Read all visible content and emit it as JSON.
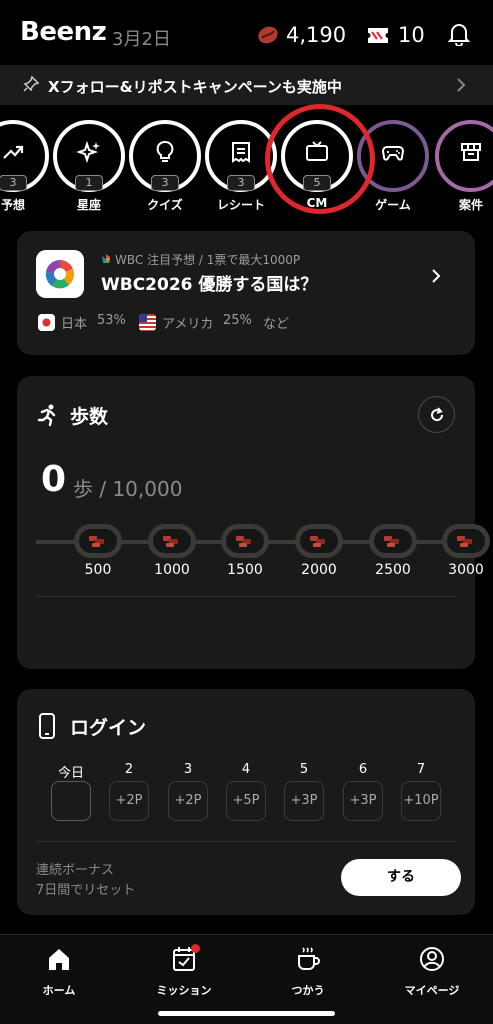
{
  "header": {
    "brand": "Beenz",
    "date": "3月2日",
    "bean_count": "4,190",
    "ticket_count": "10",
    "icons": [
      "bean-icon",
      "ticket-icon",
      "bell-icon"
    ]
  },
  "banner": {
    "text": "Xフォロー&リポストキャンペーンも実施中",
    "icon": "pin-icon"
  },
  "categories": [
    {
      "label": "予想",
      "count": "3",
      "icon": "trend-up-icon"
    },
    {
      "label": "星座",
      "count": "1",
      "icon": "sparkle-icon"
    },
    {
      "label": "クイズ",
      "count": "3",
      "icon": "lightbulb-icon"
    },
    {
      "label": "レシート",
      "count": "3",
      "icon": "receipt-icon"
    },
    {
      "label": "CM",
      "count": "5",
      "icon": "tv-icon"
    },
    {
      "label": "ゲーム",
      "count": "",
      "icon": "gamepad-icon"
    },
    {
      "label": "案件",
      "count": "",
      "icon": "shop-icon"
    }
  ],
  "prediction": {
    "tag": "WBC 注目予想 / 1票で最大1000P",
    "title": "WBC2026 優勝する国は？",
    "options": [
      {
        "name": "日本",
        "percent": "53%"
      },
      {
        "name": "アメリカ",
        "percent": "25%"
      }
    ],
    "more": "など"
  },
  "steps": {
    "title": "歩数",
    "value": "0",
    "unit_goal": "歩 / 10,000",
    "progress": 0,
    "milestones": [
      "500",
      "1000",
      "1500",
      "2000",
      "2500",
      "3000"
    ]
  },
  "login": {
    "title": "ログイン",
    "days": [
      {
        "label": "今日",
        "reward": ""
      },
      {
        "label": "2",
        "reward": "+2P"
      },
      {
        "label": "3",
        "reward": "+2P"
      },
      {
        "label": "4",
        "reward": "+5P"
      },
      {
        "label": "5",
        "reward": "+3P"
      },
      {
        "label": "6",
        "reward": "+3P"
      },
      {
        "label": "7",
        "reward": "+10P"
      }
    ],
    "bonus_title": "連続ボーナス",
    "bonus_sub": "7日間でリセット",
    "button": "する"
  },
  "tabs": [
    {
      "label": "ホーム",
      "icon": "home-icon"
    },
    {
      "label": "ミッション",
      "icon": "calendar-check-icon"
    },
    {
      "label": "つかう",
      "icon": "coffee-icon"
    },
    {
      "label": "マイページ",
      "icon": "user-icon"
    }
  ],
  "colors": {
    "background": "#000000",
    "card": "#1a1a1a",
    "accent_red": "#e0272b",
    "bean": "#c0392b"
  }
}
